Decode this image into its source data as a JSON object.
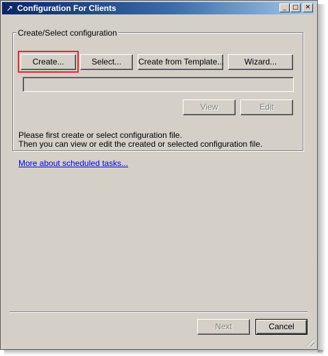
{
  "window": {
    "title": "Configuration For Clients",
    "app_icon": "↗",
    "controls": {
      "minimize": "_",
      "maximize": "□",
      "close": "✕"
    }
  },
  "group": {
    "label": "Create/Select configuration",
    "buttons": {
      "create": "Create...",
      "select": "Select...",
      "create_from_template": "Create from Template...",
      "wizard": "Wizard..."
    },
    "path_value": "",
    "view": "View",
    "edit": "Edit",
    "info_line1": "Please first create or select configuration file.",
    "info_line2": "Then you can view or edit the created or selected configuration file."
  },
  "link": "More about scheduled tasks...",
  "footer": {
    "next": "Next",
    "cancel": "Cancel"
  },
  "colors": {
    "highlight": "#e8282f",
    "link": "#0000ee",
    "title_bar": "#0a246a",
    "dialog_bg": "#d4d0c8"
  }
}
